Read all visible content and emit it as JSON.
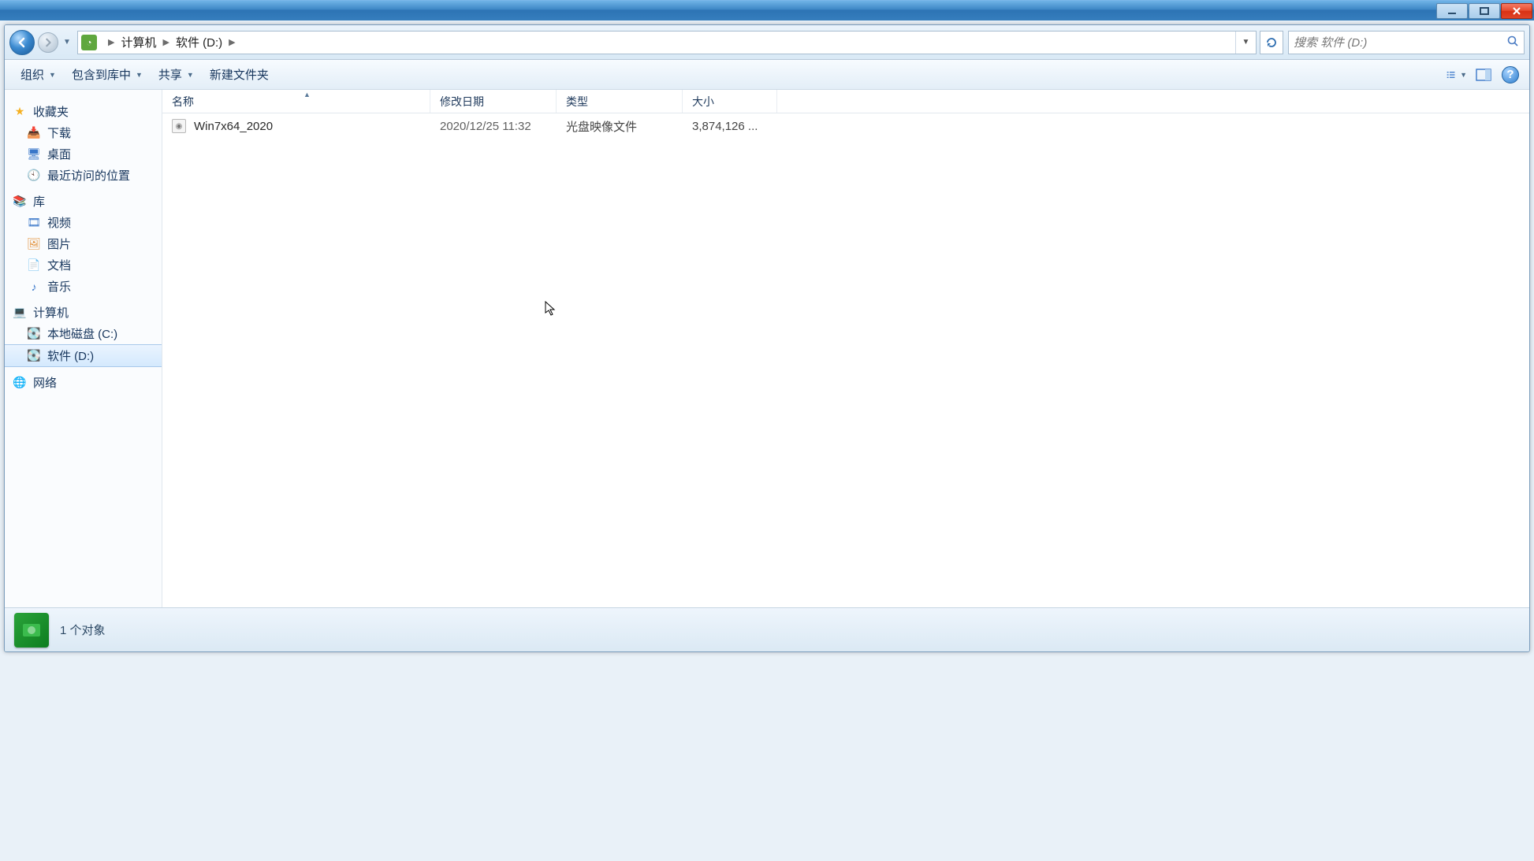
{
  "breadcrumbs": {
    "root": "计算机",
    "current": "软件 (D:)"
  },
  "search": {
    "placeholder": "搜索 软件 (D:)"
  },
  "toolbar": {
    "organize": "组织",
    "include": "包含到库中",
    "share": "共享",
    "newfolder": "新建文件夹"
  },
  "sidebar": {
    "favorites_label": "收藏夹",
    "favorites": {
      "downloads": "下载",
      "desktop": "桌面",
      "recent": "最近访问的位置"
    },
    "libraries_label": "库",
    "libraries": {
      "videos": "视频",
      "pictures": "图片",
      "documents": "文档",
      "music": "音乐"
    },
    "computer_label": "计算机",
    "drives": {
      "c": "本地磁盘 (C:)",
      "d": "软件 (D:)"
    },
    "network_label": "网络"
  },
  "columns": {
    "name": "名称",
    "date": "修改日期",
    "type": "类型",
    "size": "大小"
  },
  "files": [
    {
      "name": "Win7x64_2020",
      "date": "2020/12/25 11:32",
      "type": "光盘映像文件",
      "size": "3,874,126 ..."
    }
  ],
  "statusbar": {
    "text": "1 个对象"
  }
}
